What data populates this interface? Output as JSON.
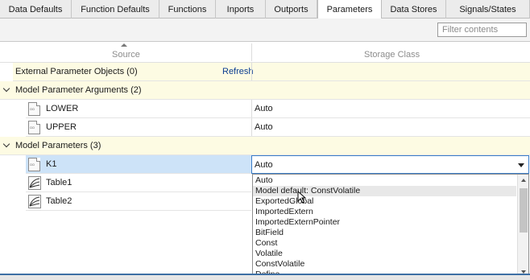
{
  "tabs": [
    {
      "label": "Data Defaults",
      "active": false
    },
    {
      "label": "Function Defaults",
      "active": false
    },
    {
      "label": "Functions",
      "active": false
    },
    {
      "label": "Inports",
      "active": false
    },
    {
      "label": "Outports",
      "active": false
    },
    {
      "label": "Parameters",
      "active": true
    },
    {
      "label": "Data Stores",
      "active": false
    },
    {
      "label": "Signals/States",
      "active": false
    }
  ],
  "filter": {
    "placeholder": "Filter contents",
    "value": ""
  },
  "columns": {
    "source": "Source",
    "storage_class": "Storage Class"
  },
  "rows": {
    "external": {
      "label": "External Parameter Objects (0)",
      "refresh": "Refresh"
    },
    "args_group": {
      "label": "Model Parameter Arguments (2)"
    },
    "lower": {
      "name": "LOWER",
      "storage": "Auto"
    },
    "upper": {
      "name": "UPPER",
      "storage": "Auto"
    },
    "params_group": {
      "label": "Model Parameters (3)"
    },
    "k1": {
      "name": "K1",
      "storage": "Auto"
    },
    "table1": {
      "name": "Table1"
    },
    "table2": {
      "name": "Table2"
    }
  },
  "dropdown": {
    "options": [
      "Auto",
      "Model default: ConstVolatile",
      "ExportedGlobal",
      "ImportedExtern",
      "ImportedExternPointer",
      "BitField",
      "Const",
      "Volatile",
      "ConstVolatile",
      "Define"
    ],
    "hovered_index": 1
  },
  "icons": {
    "parameter": "parameter-icon",
    "lookup_table": "lookup-table-icon",
    "expand": "chevron-down-icon",
    "dropdown": "dropdown-arrow-icon"
  }
}
